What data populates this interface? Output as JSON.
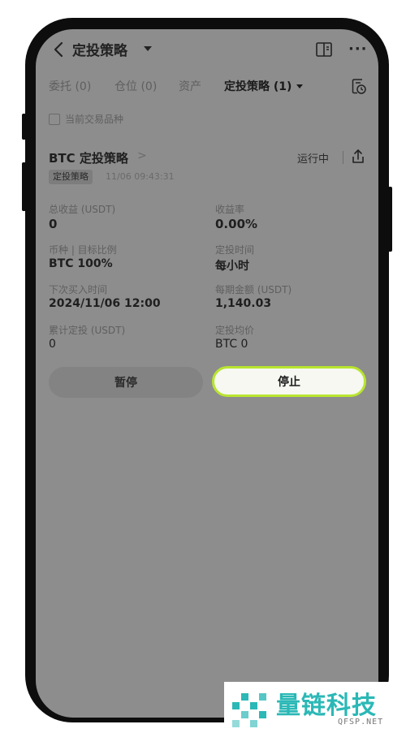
{
  "header": {
    "title": "定投策略",
    "back_icon": "chevron-left-icon",
    "book_icon": "book-icon",
    "more_label": "···"
  },
  "tabs": [
    {
      "label": "委托 (0)",
      "active": false
    },
    {
      "label": "仓位 (0)",
      "active": false
    },
    {
      "label": "资产",
      "active": false
    },
    {
      "label": "定投策略 (1)",
      "active": true
    }
  ],
  "filter": {
    "checkbox_label": "当前交易品种",
    "checked": false
  },
  "strategy": {
    "name": "BTC 定投策略",
    "chevron": ">",
    "status": "运行中",
    "tag": "定投策略",
    "created_time": "11/06 09:43:31",
    "fields": [
      {
        "label": "总收益 (USDT)",
        "value": "0"
      },
      {
        "label": "收益率",
        "value": "0.00%"
      },
      {
        "label": "币种 | 目标比例",
        "value": "BTC 100%"
      },
      {
        "label": "定投时间",
        "value": "每小时"
      },
      {
        "label": "下次买入时间",
        "value": "2024/11/06 12:00"
      },
      {
        "label": "每期金额 (USDT)",
        "value": "1,140.03"
      },
      {
        "label": "累计定投 (USDT)",
        "value": "0"
      },
      {
        "label": "定投均价",
        "value": "BTC 0"
      }
    ],
    "pause_label": "暂停",
    "stop_label": "停止"
  },
  "colors": {
    "screen_overlay": "#8d8d8d",
    "accent_green": "#b9e52e",
    "watermark_teal": "#2bb8b6"
  },
  "watermark": {
    "name": "量链科技",
    "domain": "QFSP.NET"
  }
}
